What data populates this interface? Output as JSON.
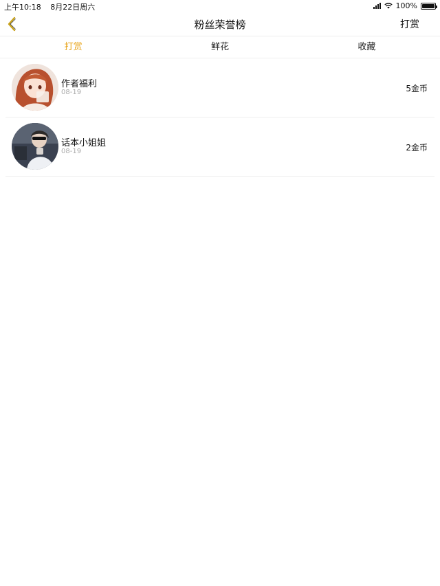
{
  "status_bar": {
    "time": "上午10:18",
    "date": "8月22日周六",
    "battery": "100%"
  },
  "nav": {
    "title": "粉丝荣誉榜",
    "right_action": "打赏",
    "back_icon": "chevron-left-icon"
  },
  "tabs": [
    {
      "label": "打赏",
      "active": true
    },
    {
      "label": "鲜花",
      "active": false
    },
    {
      "label": "收藏",
      "active": false
    }
  ],
  "list": [
    {
      "name": "作者福利",
      "date": "08-19",
      "amount": "5金币"
    },
    {
      "name": "话本小姐姐",
      "date": "08-19",
      "amount": "2金币"
    }
  ],
  "colors": {
    "accent": "#e8a317",
    "back_icon": "#c9a21a"
  }
}
